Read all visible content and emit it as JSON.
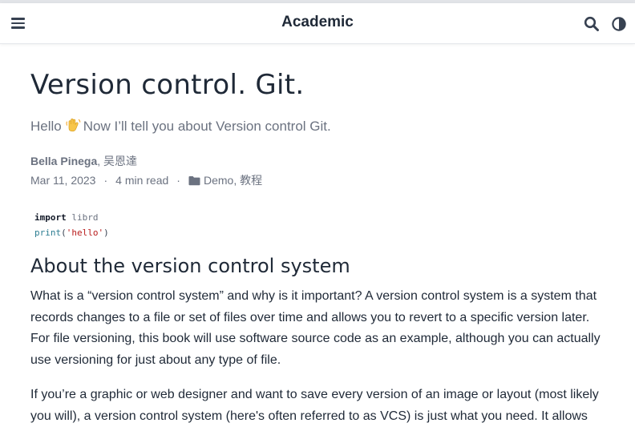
{
  "navbar": {
    "brand": "Academic",
    "icons": [
      "menu-icon",
      "search-icon",
      "theme-toggle-icon"
    ]
  },
  "article": {
    "title": "Version control. Git.",
    "subtitle_hello": "Hello",
    "subtitle_emoji": "waving-hand-emoji",
    "subtitle_text": "Now I’ll tell you about Version control Git.",
    "authors": [
      {
        "name": "Bella Pinega",
        "linked": true
      },
      {
        "name": "吴恩達",
        "linked": false
      }
    ],
    "author_separator": ", ",
    "date": "Mar 11, 2023",
    "read_time": "4 min read",
    "meta_separator": "·",
    "categories": [
      "Demo",
      "教程"
    ],
    "category_separator": ", ",
    "code": {
      "line1_keyword": "import",
      "line1_module": "librd",
      "line2_function": "print",
      "line2_open": "(",
      "line2_string": "'hello'",
      "line2_close": ")"
    },
    "section_heading": "About the version control system",
    "paragraph1": "What is a “version control system” and why is it important? A version control system is a system that records changes to a file or set of files over time and allows you to revert to a specific version later. For file versioning, this book will use software source code as an example, although you can actually use versioning for just about any type of file.",
    "paragraph2": "If you’re a graphic or web designer and want to save every version of an image or layout (most likely you will), a version control system (here's often referred to as VCS) is just what you need. It allows"
  },
  "colors": {
    "text": "#1f2937",
    "muted": "#6b7280",
    "code_function": "#2c7d92",
    "code_string": "#b91c1c",
    "topstrip": "#e2e4e8"
  }
}
